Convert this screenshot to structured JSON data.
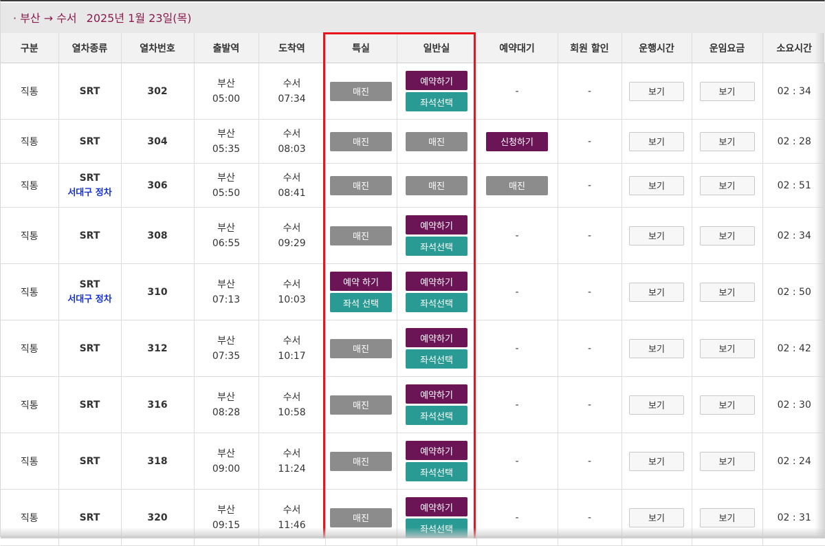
{
  "route": {
    "text": "· 부산 → 수서",
    "date": "2025년 1월 23일(목)"
  },
  "columns": [
    "구분",
    "열차종류",
    "열차번호",
    "출발역",
    "도착역",
    "특실",
    "일반실",
    "예약대기",
    "회원 할인",
    "운행시간",
    "운임요금",
    "소요시간"
  ],
  "labels": {
    "view": "보기",
    "dash": "-"
  },
  "rows": [
    {
      "category": "직통",
      "type": "SRT",
      "stop": "",
      "number": "302",
      "dep_station": "부산",
      "dep_time": "05:00",
      "arr_station": "수서",
      "arr_time": "07:34",
      "first_buttons": [
        "매진"
      ],
      "general_buttons": [
        "예약하기",
        "좌석선택"
      ],
      "waitlist": "-",
      "discount": "-",
      "duration": "02 : 34"
    },
    {
      "category": "직통",
      "type": "SRT",
      "stop": "",
      "number": "304",
      "dep_station": "부산",
      "dep_time": "05:35",
      "arr_station": "수서",
      "arr_time": "08:03",
      "first_buttons": [
        "매진"
      ],
      "general_buttons": [
        "매진"
      ],
      "waitlist": "신청하기",
      "discount": "-",
      "duration": "02 : 28"
    },
    {
      "category": "직통",
      "type": "SRT",
      "stop": "서대구 정차",
      "number": "306",
      "dep_station": "부산",
      "dep_time": "05:50",
      "arr_station": "수서",
      "arr_time": "08:41",
      "first_buttons": [
        "매진"
      ],
      "general_buttons": [
        "매진"
      ],
      "waitlist": "매진",
      "discount": "-",
      "duration": "02 : 51"
    },
    {
      "category": "직통",
      "type": "SRT",
      "stop": "",
      "number": "308",
      "dep_station": "부산",
      "dep_time": "06:55",
      "arr_station": "수서",
      "arr_time": "09:29",
      "first_buttons": [
        "매진"
      ],
      "general_buttons": [
        "예약하기",
        "좌석선택"
      ],
      "waitlist": "-",
      "discount": "-",
      "duration": "02 : 34"
    },
    {
      "category": "직통",
      "type": "SRT",
      "stop": "서대구 정차",
      "number": "310",
      "dep_station": "부산",
      "dep_time": "07:13",
      "arr_station": "수서",
      "arr_time": "10:03",
      "first_buttons": [
        "예약 하기",
        "좌석 선택"
      ],
      "general_buttons": [
        "예약하기",
        "좌석선택"
      ],
      "waitlist": "-",
      "discount": "-",
      "duration": "02 : 50"
    },
    {
      "category": "직통",
      "type": "SRT",
      "stop": "",
      "number": "312",
      "dep_station": "부산",
      "dep_time": "07:35",
      "arr_station": "수서",
      "arr_time": "10:17",
      "first_buttons": [
        "매진"
      ],
      "general_buttons": [
        "예약하기",
        "좌석선택"
      ],
      "waitlist": "-",
      "discount": "-",
      "duration": "02 : 42"
    },
    {
      "category": "직통",
      "type": "SRT",
      "stop": "",
      "number": "316",
      "dep_station": "부산",
      "dep_time": "08:28",
      "arr_station": "수서",
      "arr_time": "10:58",
      "first_buttons": [
        "매진"
      ],
      "general_buttons": [
        "예약하기",
        "좌석선택"
      ],
      "waitlist": "-",
      "discount": "-",
      "duration": "02 : 30"
    },
    {
      "category": "직통",
      "type": "SRT",
      "stop": "",
      "number": "318",
      "dep_station": "부산",
      "dep_time": "09:00",
      "arr_station": "수서",
      "arr_time": "11:24",
      "first_buttons": [
        "매진"
      ],
      "general_buttons": [
        "예약하기",
        "좌석선택"
      ],
      "waitlist": "-",
      "discount": "-",
      "duration": "02 : 24"
    },
    {
      "category": "직통",
      "type": "SRT",
      "stop": "",
      "number": "320",
      "dep_station": "부산",
      "dep_time": "09:15",
      "arr_station": "수서",
      "arr_time": "11:46",
      "first_buttons": [
        "매진"
      ],
      "general_buttons": [
        "예약하기",
        "좌석선택"
      ],
      "waitlist": "-",
      "discount": "-",
      "duration": "02 : 31"
    }
  ],
  "colors": {
    "route_text": "#8a1b4c",
    "soldout": "#8c8c8c",
    "reserve": "#6b1557",
    "seat_select": "#2a9a94",
    "stop_note": "#1530d6",
    "highlight_box": "#e8131c"
  }
}
